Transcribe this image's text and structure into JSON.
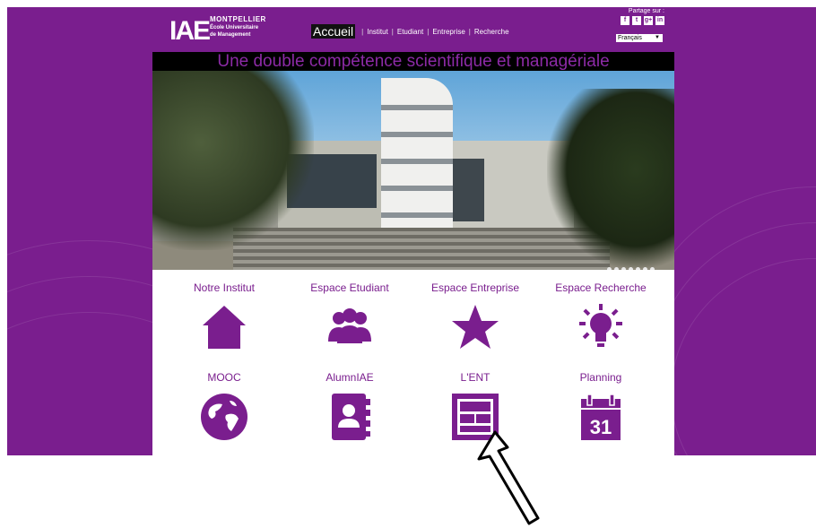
{
  "header": {
    "logo": {
      "mark": "IAE",
      "line1": "MONTPELLIER",
      "line2": "École Universitaire",
      "line3": "de Management"
    },
    "nav": [
      {
        "label": "Accueil",
        "active": true
      },
      {
        "label": "Institut",
        "active": false
      },
      {
        "label": "Etudiant",
        "active": false
      },
      {
        "label": "Entreprise",
        "active": false
      },
      {
        "label": "Recherche",
        "active": false
      }
    ],
    "nav_separator": "|",
    "share": {
      "label": "Partage sur :",
      "icons": [
        "facebook-icon",
        "twitter-icon",
        "google-plus-icon",
        "linkedin-icon"
      ],
      "glyphs": [
        "f",
        "t",
        "g+",
        "in"
      ]
    },
    "language": {
      "selected": "Français"
    }
  },
  "banner": {
    "text": "Une double compétence scientifique et managériale"
  },
  "slider": {
    "dot_count": 7
  },
  "tiles": [
    {
      "label": "Notre Institut",
      "icon": "home-icon"
    },
    {
      "label": "Espace Etudiant",
      "icon": "people-icon"
    },
    {
      "label": "Espace Entreprise",
      "icon": "star-icon"
    },
    {
      "label": "Espace Recherche",
      "icon": "lightbulb-icon"
    },
    {
      "label": "MOOC",
      "icon": "globe-icon"
    },
    {
      "label": "AlumnIAE",
      "icon": "contact-book-icon"
    },
    {
      "label": "L'ENT",
      "icon": "ent-window-icon"
    },
    {
      "label": "Planning",
      "icon": "calendar-icon",
      "day": "31"
    }
  ],
  "colors": {
    "brand_purple": "#7a1e8e",
    "banner_text": "#8c2aa6",
    "banner_bg": "#000000"
  }
}
